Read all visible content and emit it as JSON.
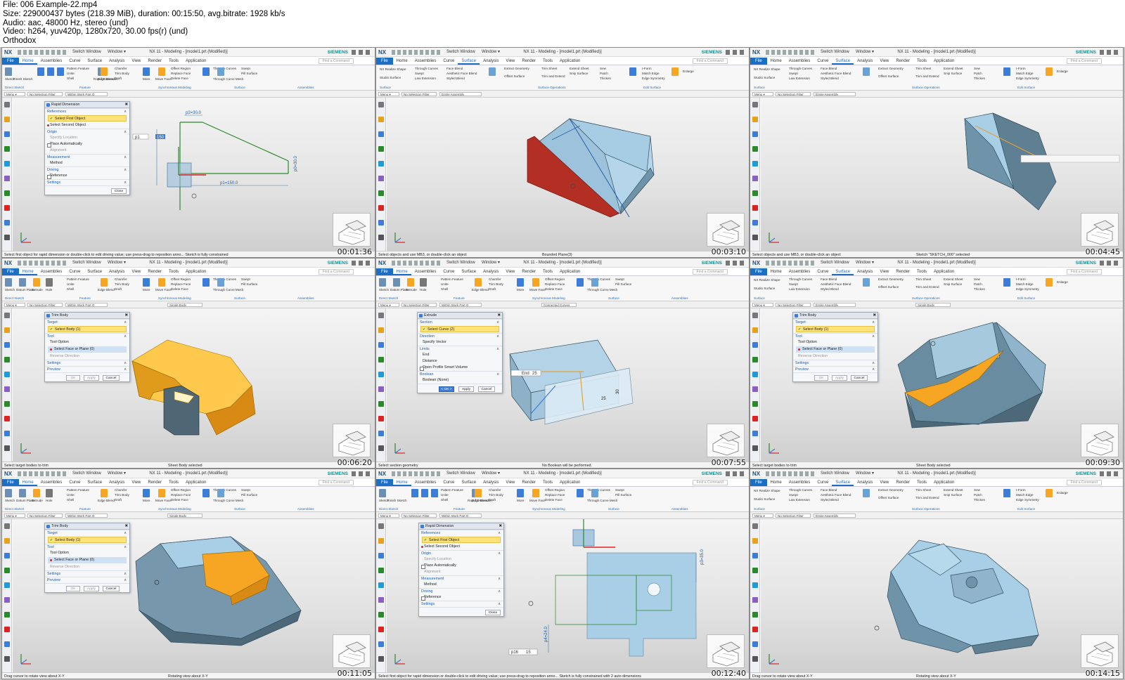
{
  "header": {
    "lines": [
      "File: 006 Example-22.mp4",
      "Size: 229000437 bytes (218.39 MiB), duration: 00:15:50, avg.bitrate: 1928 kb/s",
      "Audio: aac, 48000 Hz, stereo (und)",
      "Video: h264, yuv420p, 1280x720, 30.00 fps(r) (und)",
      "Orthodox"
    ]
  },
  "app": {
    "nx": "NX",
    "switch_window": "Switch Window",
    "window_menu": "Window ▾",
    "title": "NX 11 - Modeling - [model1.prt (Modified)]",
    "brand": "SIEMENS",
    "find_placeholder": "Find a Command",
    "menu": "Menu ▾",
    "no_filter": "No Selection Filter",
    "work_part": "Within Work Part O",
    "entire_assembly": "Entire Assembly",
    "single_body": "Single Body",
    "connected_curves": "Connected Curves"
  },
  "tabs_home": [
    "File",
    "Home",
    "Assemblies",
    "Curve",
    "Surface",
    "Analysis",
    "View",
    "Render",
    "Tools",
    "Application"
  ],
  "tabs_surface": [
    "File",
    "Home",
    "Assemblies",
    "Curve",
    "Surface",
    "Analysis",
    "View",
    "Render",
    "Tools",
    "Application"
  ],
  "groups": {
    "direct_sketch": "Direct Sketch",
    "feature": "Feature",
    "synchronous": "Synchronous Modeling",
    "surface": "Surface",
    "assemblies": "Assemblies",
    "surface_operations": "Surface Operations",
    "edit_surface": "Edit Surface"
  },
  "ribbon_labels": {
    "sketch": "Sketch",
    "finish_sketch": "Finish Sketch",
    "datum_plane": "Datum Plane",
    "extrude": "Extrude",
    "hole": "Hole",
    "pattern_feature": "Pattern Feature",
    "unite": "Unite",
    "shell": "Shell",
    "edge_blend": "Edge Blend",
    "chamfer": "Chamfer",
    "trim_body": "Trim Body",
    "draft": "Draft",
    "more": "More",
    "move_face": "Move Face",
    "offset_region": "Offset Region",
    "replace_face": "Replace Face",
    "delete_face": "Delete Face",
    "through_curves": "Through Curves",
    "through_curve_mesh": "Through Curve Mesh",
    "swept": "Swept",
    "pill_surface": "Pill Surface",
    "nx_realize_shape": "NX Realize Shape",
    "studio_surface": "Studio Surface",
    "aesthetic_face_blend": "Aesthetic Face Blend",
    "face_blend": "Face Blend",
    "styled_blend": "Styled Blend",
    "law_extension": "Law Extension",
    "extract_geometry": "Extract Geometry",
    "offset_surface": "Offset Surface",
    "trim_sheet": "Trim Sheet",
    "trim_and_extend": "Trim and Extend",
    "extend_sheet": "Extend Sheet",
    "snip_surface": "Snip Surface",
    "sew": "Sew",
    "patch": "Patch",
    "thicken": "Thicken",
    "i_form": "I-Form",
    "match_edge": "Match Edge",
    "edge_symmetry": "Edge Symmetry",
    "enlarge": "Enlarge",
    "rapid_dimension": "Rapid Dimension"
  },
  "frames": [
    {
      "timestamp": "00:01:36",
      "status": "Select first object for rapid dimension or double-click to edit driving value; use press-drag to reposition anno... Sketch is fully constrained",
      "status2": ""
    },
    {
      "timestamp": "00:03:10",
      "status": "Select objects and use MB3, or double-click an object",
      "status2": "Bounded Plane(3)"
    },
    {
      "timestamp": "00:04:45",
      "status": "Select objects and use MB3, or double-click an object",
      "status2": "Sketch \"SKETCH_000\" selected"
    },
    {
      "timestamp": "00:06:20",
      "status": "Select target bodies to trim",
      "status2": "Sheet Body selected"
    },
    {
      "timestamp": "00:07:55",
      "status": "Select section geometry",
      "status2": "No Boolean will be performed."
    },
    {
      "timestamp": "00:09:30",
      "status": "Select target bodies to trim",
      "status2": "Sheet Body selected"
    },
    {
      "timestamp": "00:11:05",
      "status": "Drag cursor to rotate view about X-Y",
      "status2": "Rotating view about X-Y"
    },
    {
      "timestamp": "00:12:40",
      "status": "Select first object for rapid dimension or double-click to edit driving value; use press-drag to reposition anno... Sketch is fully constrained with 2 auto dimensions",
      "status2": ""
    },
    {
      "timestamp": "00:14:15",
      "status": "Drag cursor to rotate view about X-Y",
      "status2": "Rotating view about X-Y"
    }
  ],
  "rapid_dimension": {
    "title": "Rapid Dimension",
    "references": "References",
    "select_first": "Select First Object",
    "select_second": "Select Second Object",
    "origin": "Origin",
    "specify_location": "Specify Location",
    "place_automatically": "Place Automatically",
    "alignment": "Alignment",
    "measurement": "Measurement",
    "method": "Method",
    "method_value": "Inferred",
    "driving": "Driving",
    "reference": "Reference",
    "settings": "Settings",
    "close": "Close"
  },
  "trim_body": {
    "title": "Trim Body",
    "target": "Target",
    "select_body": "Select Body (1)",
    "tool": "Tool",
    "tool_option": "Tool Option",
    "tool_option_value": "Face or Plane",
    "select_face": "Select Face or Plane (0)",
    "reverse_direction": "Reverse Direction",
    "settings": "Settings",
    "preview": "Preview",
    "ok": "OK",
    "apply": "Apply",
    "cancel": "Cancel"
  },
  "extrude": {
    "title": "Extrude",
    "section": "Section",
    "select_curve": "Select Curve (2)",
    "direction": "Direction",
    "specify_vector": "Specify Vector",
    "limits": "Limits",
    "end": "End",
    "end_value": "Symmetric Value",
    "distance": "Distance",
    "distance_value": "25",
    "distance_unit": "mm",
    "open_profile": "Open Profile Smart Volume",
    "boolean": "Boolean",
    "boolean_label": "Boolean (None)",
    "boolean_value": "Inferred",
    "ok": "< OK >",
    "apply": "Apply",
    "cancel": "Cancel",
    "end_popup": "End",
    "end_popup_value": "25"
  },
  "annotations": {
    "p2": "p2=30.0",
    "p1": "p1=150.0",
    "p0": "p0=30.0",
    "p_input_label": "p1",
    "p_input_value": "150",
    "d25": "25",
    "d30": "30",
    "p_right": "p3=35.0",
    "p_left": "p4=24.0",
    "p_bottom_label": "p16",
    "p_bottom_value": "15"
  },
  "colors": {
    "part_blue": "#a9cfe6",
    "part_dark": "#5f7f93",
    "selected_orange": "#f6a623",
    "highlight_red": "#b32f23",
    "file_tab": "#1a6fc4",
    "siemens_teal": "#009999"
  }
}
